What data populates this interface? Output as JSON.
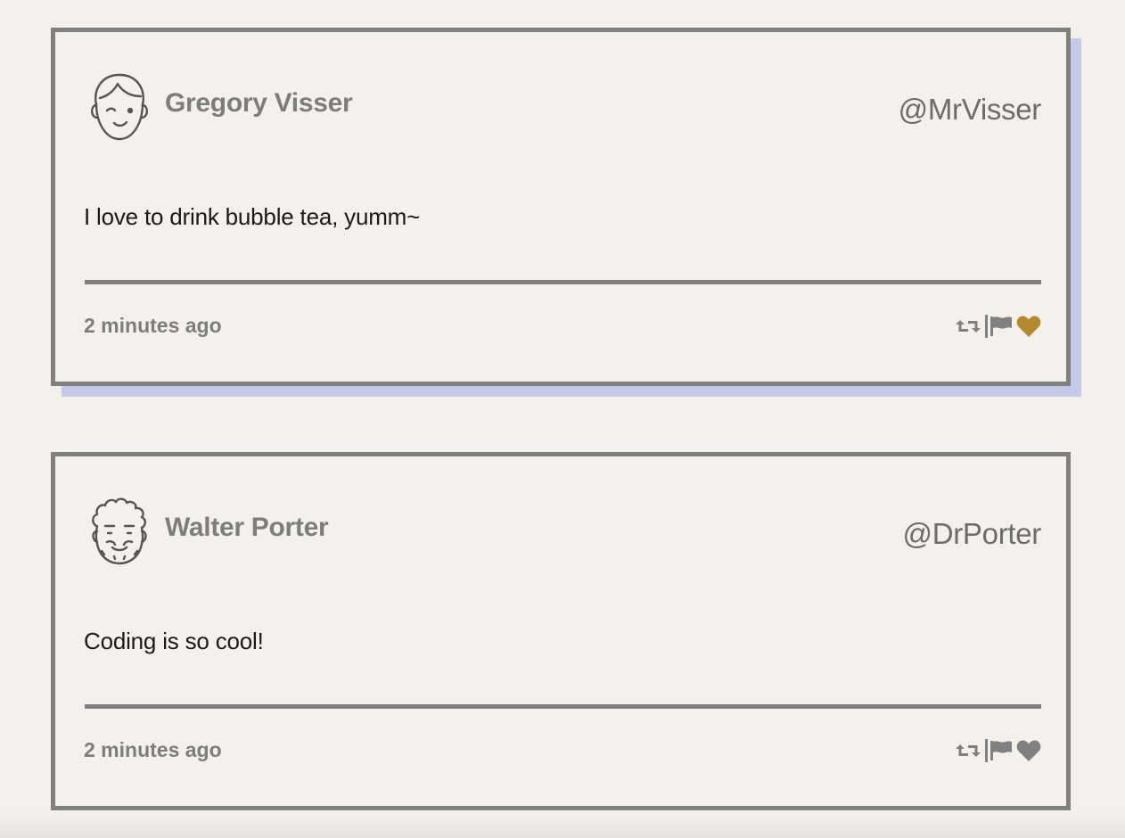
{
  "colors": {
    "border": "#808080",
    "background": "#f4f1ec",
    "shadow": "#c3cbe9",
    "heart_active": "#b58a2e",
    "heart_inactive": "#808080"
  },
  "tweets": [
    {
      "avatar_icon": "winking-boy-face-icon",
      "name": "Gregory Visser",
      "handle": "@MrVisser",
      "message": "I love to drink bubble tea, yumm~",
      "time": "2 minutes ago",
      "liked": true
    },
    {
      "avatar_icon": "curly-hair-bearded-face-icon",
      "name": "Walter Porter",
      "handle": "@DrPorter",
      "message": "Coding is so cool!",
      "time": "2 minutes ago",
      "liked": false
    }
  ]
}
